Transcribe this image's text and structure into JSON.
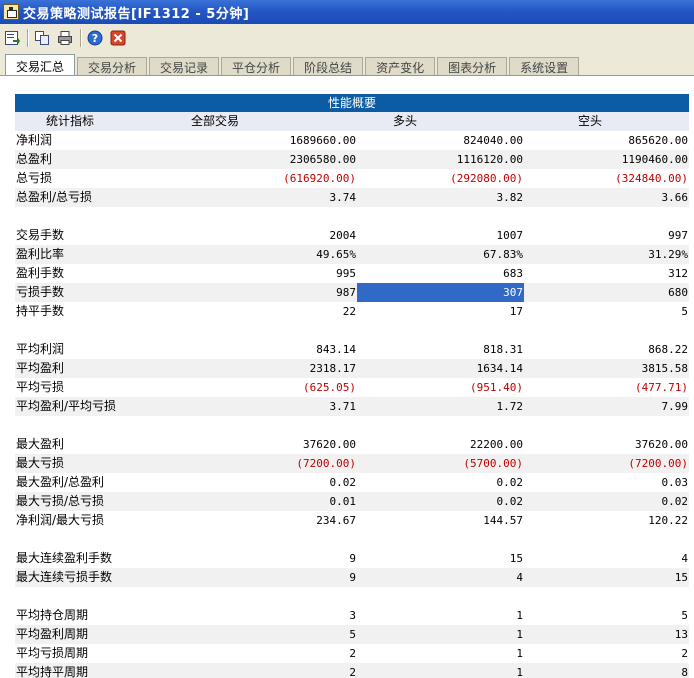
{
  "window": {
    "title": "交易策略测试报告[IF1312 - 5分钟]"
  },
  "toolbar": {
    "buttons": [
      "export-icon",
      "copy-icon",
      "print-icon",
      "help-icon",
      "close-icon"
    ]
  },
  "tabs": [
    "交易汇总",
    "交易分析",
    "交易记录",
    "平仓分析",
    "阶段总结",
    "资产变化",
    "图表分析",
    "系统设置"
  ],
  "active_tab": 0,
  "report": {
    "section_title": "性能概要",
    "columns": [
      "统计指标",
      "全部交易",
      "多头",
      "空头"
    ],
    "groups": [
      {
        "rows": [
          {
            "label": "净利润",
            "values": [
              "1689660.00",
              "824040.00",
              "865620.00"
            ],
            "neg": [
              false,
              false,
              false
            ]
          },
          {
            "label": "总盈利",
            "values": [
              "2306580.00",
              "1116120.00",
              "1190460.00"
            ],
            "neg": [
              false,
              false,
              false
            ]
          },
          {
            "label": "总亏损",
            "values": [
              "(616920.00)",
              "(292080.00)",
              "(324840.00)"
            ],
            "neg": [
              true,
              true,
              true
            ]
          },
          {
            "label": "总盈利/总亏损",
            "values": [
              "3.74",
              "3.82",
              "3.66"
            ],
            "neg": [
              false,
              false,
              false
            ]
          }
        ]
      },
      {
        "rows": [
          {
            "label": "交易手数",
            "values": [
              "2004",
              "1007",
              "997"
            ],
            "neg": [
              false,
              false,
              false
            ]
          },
          {
            "label": "盈利比率",
            "values": [
              "49.65%",
              "67.83%",
              "31.29%"
            ],
            "neg": [
              false,
              false,
              false
            ]
          },
          {
            "label": "盈利手数",
            "values": [
              "995",
              "683",
              "312"
            ],
            "neg": [
              false,
              false,
              false
            ]
          },
          {
            "label": "亏损手数",
            "values": [
              "987",
              "307",
              "680"
            ],
            "neg": [
              false,
              false,
              false
            ],
            "selected_col": 1
          },
          {
            "label": "持平手数",
            "values": [
              "22",
              "17",
              "5"
            ],
            "neg": [
              false,
              false,
              false
            ]
          }
        ]
      },
      {
        "rows": [
          {
            "label": "平均利润",
            "values": [
              "843.14",
              "818.31",
              "868.22"
            ],
            "neg": [
              false,
              false,
              false
            ]
          },
          {
            "label": "平均盈利",
            "values": [
              "2318.17",
              "1634.14",
              "3815.58"
            ],
            "neg": [
              false,
              false,
              false
            ]
          },
          {
            "label": "平均亏损",
            "values": [
              "(625.05)",
              "(951.40)",
              "(477.71)"
            ],
            "neg": [
              true,
              true,
              true
            ]
          },
          {
            "label": "平均盈利/平均亏损",
            "values": [
              "3.71",
              "1.72",
              "7.99"
            ],
            "neg": [
              false,
              false,
              false
            ]
          }
        ]
      },
      {
        "rows": [
          {
            "label": "最大盈利",
            "values": [
              "37620.00",
              "22200.00",
              "37620.00"
            ],
            "neg": [
              false,
              false,
              false
            ]
          },
          {
            "label": "最大亏损",
            "values": [
              "(7200.00)",
              "(5700.00)",
              "(7200.00)"
            ],
            "neg": [
              true,
              true,
              true
            ]
          },
          {
            "label": "最大盈利/总盈利",
            "values": [
              "0.02",
              "0.02",
              "0.03"
            ],
            "neg": [
              false,
              false,
              false
            ]
          },
          {
            "label": "最大亏损/总亏损",
            "values": [
              "0.01",
              "0.02",
              "0.02"
            ],
            "neg": [
              false,
              false,
              false
            ]
          },
          {
            "label": "净利润/最大亏损",
            "values": [
              "234.67",
              "144.57",
              "120.22"
            ],
            "neg": [
              false,
              false,
              false
            ]
          }
        ]
      },
      {
        "rows": [
          {
            "label": "最大连续盈利手数",
            "values": [
              "9",
              "15",
              "4"
            ],
            "neg": [
              false,
              false,
              false
            ]
          },
          {
            "label": "最大连续亏损手数",
            "values": [
              "9",
              "4",
              "15"
            ],
            "neg": [
              false,
              false,
              false
            ]
          }
        ]
      },
      {
        "rows": [
          {
            "label": "平均持仓周期",
            "values": [
              "3",
              "1",
              "5"
            ],
            "neg": [
              false,
              false,
              false
            ]
          },
          {
            "label": "平均盈利周期",
            "values": [
              "5",
              "1",
              "13"
            ],
            "neg": [
              false,
              false,
              false
            ]
          },
          {
            "label": "平均亏损周期",
            "values": [
              "2",
              "1",
              "2"
            ],
            "neg": [
              false,
              false,
              false
            ]
          },
          {
            "label": "平均持平周期",
            "values": [
              "2",
              "1",
              "8"
            ],
            "neg": [
              false,
              false,
              false
            ]
          }
        ]
      }
    ]
  },
  "colors": {
    "title_bar": "#2457c4",
    "section_header": "#0b5ca3",
    "negative": "#c00000",
    "selection": "#3169c6"
  }
}
